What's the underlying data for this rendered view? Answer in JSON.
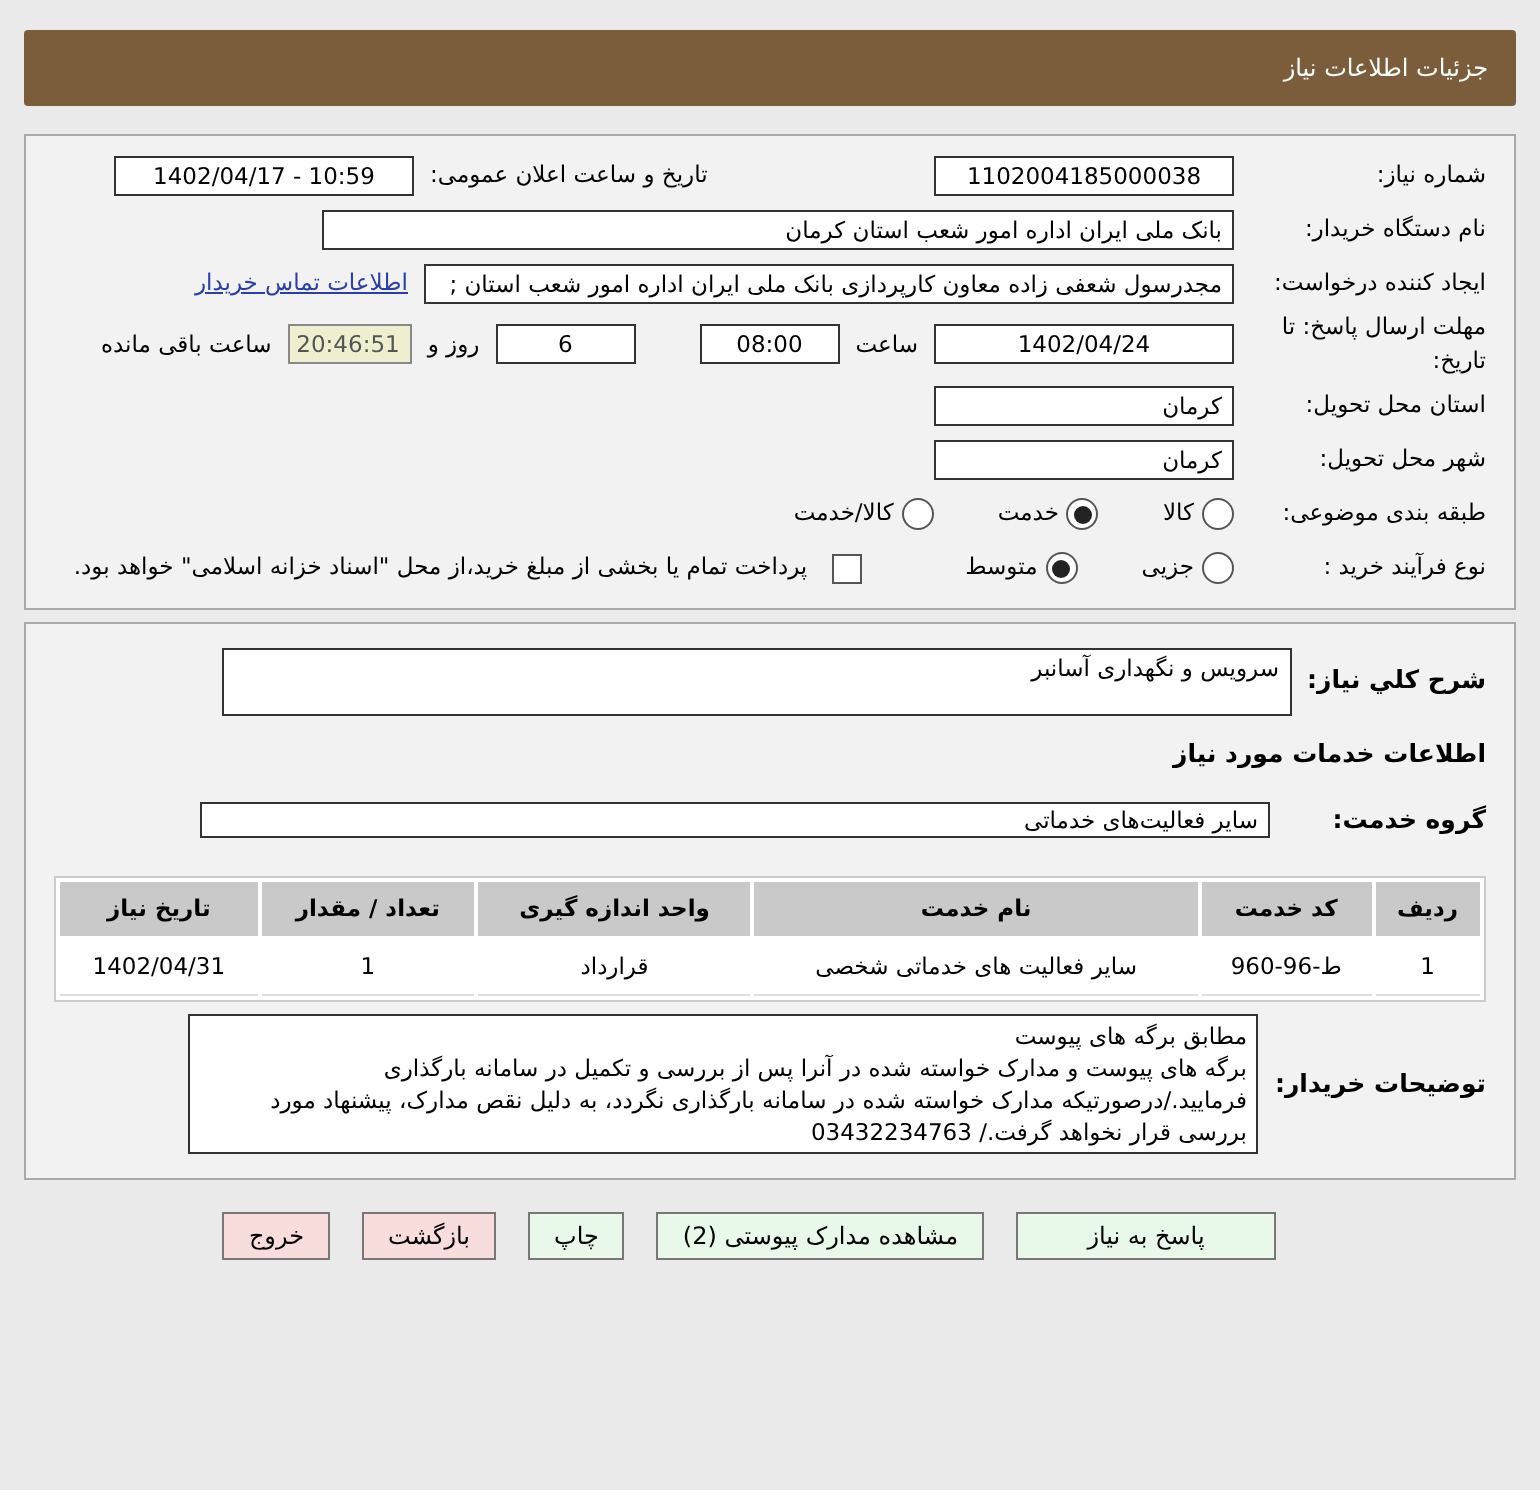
{
  "header": {
    "title": "جزئیات اطلاعات نیاز"
  },
  "need_number": {
    "label": "شماره نیاز:",
    "value": "1102004185000038"
  },
  "announce": {
    "label": "تاریخ و ساعت اعلان عمومی:",
    "value": "1402/04/17 - 10:59"
  },
  "buyer_org": {
    "label": "نام دستگاه خریدار:",
    "value": "بانک ملی ایران اداره امور شعب استان کرمان"
  },
  "requester": {
    "label": "ایجاد کننده درخواست:",
    "value": "مجدرسول شعفی زاده معاون کارپردازی بانک ملی ایران اداره امور شعب استان ;",
    "link": "اطلاعات تماس خریدار"
  },
  "deadline": {
    "label": "مهلت ارسال پاسخ: تا تاریخ:",
    "date": "1402/04/24",
    "time_label": "ساعت",
    "time": "08:00",
    "days": "6",
    "days_label": "روز و",
    "remaining": "20:46:51",
    "remaining_label": "ساعت باقی مانده"
  },
  "province": {
    "label": "استان محل تحویل:",
    "value": "کرمان"
  },
  "city": {
    "label": "شهر محل تحویل:",
    "value": "کرمان"
  },
  "category": {
    "label": "طبقه بندی موضوعی:",
    "options": [
      {
        "label": "کالا",
        "selected": false
      },
      {
        "label": "خدمت",
        "selected": true
      },
      {
        "label": "کالا/خدمت",
        "selected": false
      }
    ]
  },
  "process": {
    "label": "نوع فرآیند خرید :",
    "options": [
      {
        "label": "جزیی",
        "selected": false
      },
      {
        "label": "متوسط",
        "selected": true
      }
    ],
    "payment": {
      "checked": false,
      "label": "پرداخت تمام یا بخشی از مبلغ خرید،از محل \"اسناد خزانه اسلامی\" خواهد بود."
    }
  },
  "summary": {
    "label": "شرح کلي نیاز:",
    "value": "سرویس و نگهداری آسانبر"
  },
  "services_title": "اطلاعات خدمات مورد نیاز",
  "service_group": {
    "label": "گروه خدمت:",
    "value": "سایر فعالیت‌های خدماتی"
  },
  "table": {
    "columns": [
      "ردیف",
      "کد خدمت",
      "نام خدمت",
      "واحد اندازه گیری",
      "تعداد / مقدار",
      "تاریخ نیاز"
    ],
    "rows": [
      [
        "1",
        "ط-96-960",
        "سایر فعالیت های خدماتی شخصی",
        "قرارداد",
        "1",
        "1402/04/31"
      ]
    ]
  },
  "buyer_notes": {
    "label": "توضیحات خریدار:",
    "value": "مطابق برگه های پیوست\nبرگه های پیوست و مدارک خواسته شده در آنرا پس از بررسی و تکمیل در سامانه بارگذاری\nفرمایید./درصورتیکه مدارک خواسته شده در سامانه بارگذاری نگردد، به دلیل نقص مدارک، پیشنهاد مورد\nبررسی قرار نخواهد گرفت./ 03432234763"
  },
  "buttons": [
    {
      "label": "پاسخ به نیاز",
      "kind": "action"
    },
    {
      "label": "مشاهده مدارک پیوستی (2)",
      "kind": "action"
    },
    {
      "label": "چاپ",
      "kind": "action"
    },
    {
      "label": "بازگشت",
      "kind": "exit"
    },
    {
      "label": "خروج",
      "kind": "exit"
    }
  ]
}
